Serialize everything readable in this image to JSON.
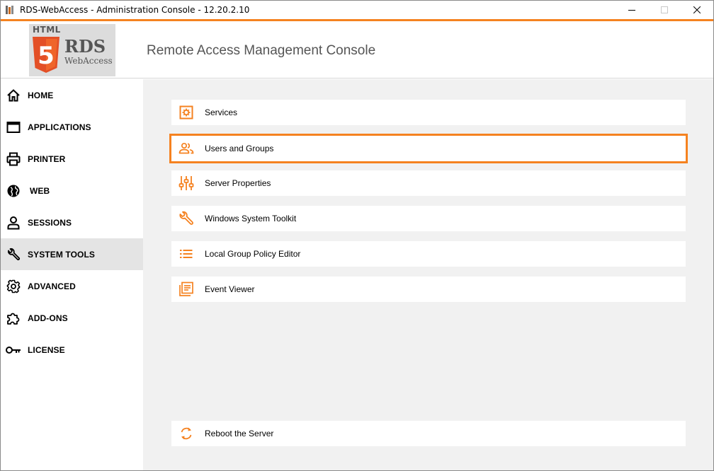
{
  "window": {
    "title": "RDS-WebAccess - Administration Console - 12.20.2.10",
    "accent_color": "#f58220"
  },
  "header": {
    "logo_html": "HTML",
    "logo_five": "5",
    "logo_rds": "RDS",
    "logo_webaccess": "WebAccess",
    "title": "Remote Access Management Console"
  },
  "sidebar": {
    "items": [
      {
        "label": "HOME",
        "icon": "home-icon"
      },
      {
        "label": "APPLICATIONS",
        "icon": "window-icon"
      },
      {
        "label": "PRINTER",
        "icon": "printer-icon"
      },
      {
        "label": "WEB",
        "icon": "globe-icon"
      },
      {
        "label": "SESSIONS",
        "icon": "user-icon"
      },
      {
        "label": "SYSTEM TOOLS",
        "icon": "wrench-icon",
        "active": true
      },
      {
        "label": "ADVANCED",
        "icon": "gear-icon"
      },
      {
        "label": "ADD-ONS",
        "icon": "puzzle-icon"
      },
      {
        "label": "LICENSE",
        "icon": "key-icon"
      }
    ]
  },
  "tools": {
    "items": [
      {
        "label": "Services",
        "icon": "services-icon"
      },
      {
        "label": "Users and Groups",
        "icon": "users-icon",
        "selected": true
      },
      {
        "label": "Server Properties",
        "icon": "sliders-icon"
      },
      {
        "label": "Windows System Toolkit",
        "icon": "wrench-icon"
      },
      {
        "label": "Local Group Policy Editor",
        "icon": "list-icon"
      },
      {
        "label": "Event Viewer",
        "icon": "log-icon"
      }
    ],
    "reboot": {
      "label": "Reboot the Server",
      "icon": "refresh-icon"
    }
  }
}
